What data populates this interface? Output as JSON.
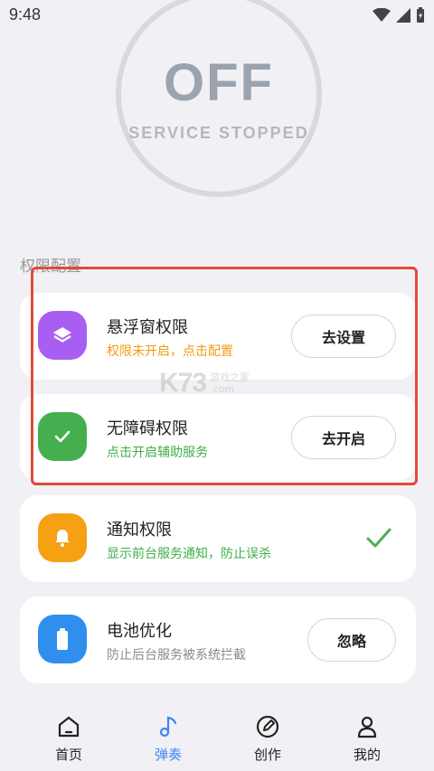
{
  "status_bar": {
    "time": "9:48"
  },
  "service": {
    "state": "OFF",
    "subtitle": "SERVICE STOPPED"
  },
  "section_title": "权限配置",
  "permissions": [
    {
      "title": "悬浮窗权限",
      "subtitle": "权限未开启，点击配置",
      "subtitle_color": "#f39a14",
      "icon": "layers-icon",
      "icon_color": "#a85ef2",
      "action": "去设置"
    },
    {
      "title": "无障碍权限",
      "subtitle": "点击开启辅助服务",
      "subtitle_color": "#3fae4a",
      "icon": "check-icon",
      "icon_color": "#45ae4e",
      "action": "去开启"
    },
    {
      "title": "通知权限",
      "subtitle": "显示前台服务通知，防止误杀",
      "subtitle_color": "#3fae4a",
      "icon": "bell-icon",
      "icon_color": "#f6a013",
      "action": null
    },
    {
      "title": "电池优化",
      "subtitle": "防止后台服务被系统拦截",
      "subtitle_color": "#8a8a8a",
      "icon": "battery-icon",
      "icon_color": "#2f8fee",
      "action": "忽略"
    }
  ],
  "watermark": {
    "logo": "K73",
    "line1": "游戏之家",
    "line2": ".com"
  },
  "nav": [
    {
      "label": "首页",
      "icon": "home-icon",
      "active": false
    },
    {
      "label": "弹奏",
      "icon": "music-note-icon",
      "active": true
    },
    {
      "label": "创作",
      "icon": "edit-icon",
      "active": false
    },
    {
      "label": "我的",
      "icon": "user-icon",
      "active": false
    }
  ],
  "colors": {
    "accent": "#3f86f0",
    "highlight_border": "#e14a3a",
    "background": "#f1f1f5"
  }
}
